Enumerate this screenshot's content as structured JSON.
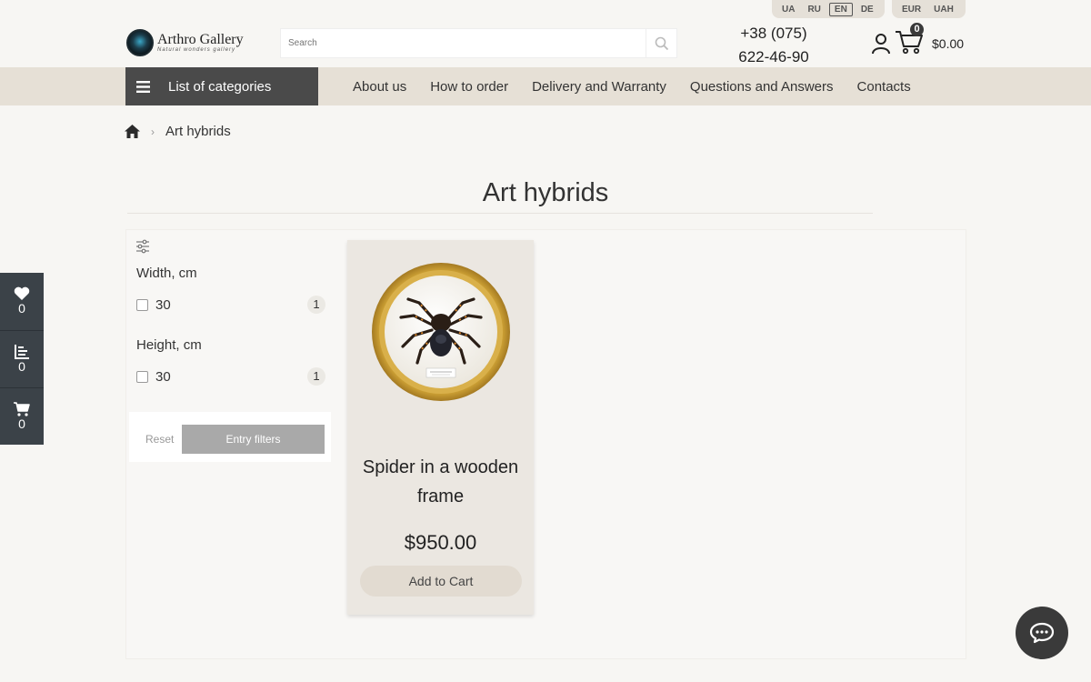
{
  "languages": [
    "UA",
    "RU",
    "EN",
    "DE"
  ],
  "active_language": "EN",
  "currencies": [
    "EUR",
    "UAH"
  ],
  "logo": {
    "title": "Arthro Gallery",
    "subtitle": "Natural wonders gallery"
  },
  "search": {
    "placeholder": "Search"
  },
  "phone": {
    "line1": "+38 (075)",
    "line2": "622-46-90"
  },
  "cart": {
    "count": "0",
    "total": "$0.00"
  },
  "nav": {
    "categories_label": "List of categories",
    "links": [
      "About us",
      "How to order",
      "Delivery and Warranty",
      "Questions and Answers",
      "Contacts"
    ]
  },
  "breadcrumb": {
    "current": "Art hybrids"
  },
  "page_title": "Art hybrids",
  "filters": {
    "groups": [
      {
        "title": "Width, cm",
        "options": [
          {
            "value": "30",
            "count": "1"
          }
        ]
      },
      {
        "title": "Height, cm",
        "options": [
          {
            "value": "30",
            "count": "1"
          }
        ]
      }
    ],
    "reset_label": "Reset",
    "apply_label": "Entry filters"
  },
  "product": {
    "name": "Spider in a wooden frame",
    "price": "$950.00",
    "add_to_cart_label": "Add to Cart"
  },
  "side_widget": {
    "favorites_count": "0",
    "compare_count": "0",
    "cart_count": "0"
  },
  "colors": {
    "nav_bg": "#e6e0d6",
    "dark": "#4a4a4a",
    "page_bg": "#f7f6f3"
  }
}
